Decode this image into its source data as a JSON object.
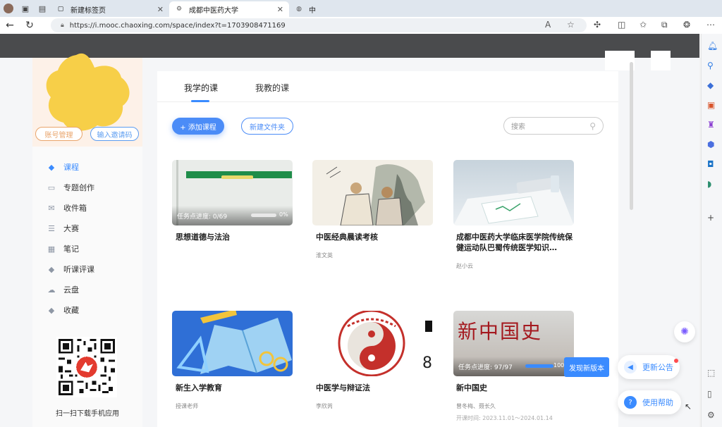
{
  "browser": {
    "tabs": [
      {
        "title": "新建标签页",
        "active": false
      },
      {
        "title": "成都中医药大学",
        "active": true
      },
      {
        "title": "中",
        "active": false
      }
    ],
    "url": "https://i.mooc.chaoxing.com/space/index?t=1703908471169",
    "url_host": "i.mooc.chaoxing.com"
  },
  "profile": {
    "account_btn": "账号管理",
    "invite_btn": "输入邀请码"
  },
  "sidebar": {
    "items": [
      {
        "label": "课程",
        "icon": "graduation-cap-icon",
        "active": true
      },
      {
        "label": "专题创作",
        "icon": "topic-icon",
        "active": false
      },
      {
        "label": "收件箱",
        "icon": "inbox-icon",
        "active": false
      },
      {
        "label": "大赛",
        "icon": "list-icon",
        "active": false
      },
      {
        "label": "笔记",
        "icon": "note-icon",
        "active": false
      },
      {
        "label": "听课评课",
        "icon": "graduation-cap-icon",
        "active": false
      },
      {
        "label": "云盘",
        "icon": "cloud-icon",
        "active": false
      },
      {
        "label": "收藏",
        "icon": "graduation-cap-icon",
        "active": false
      }
    ],
    "qr_caption": "扫一扫下载手机应用"
  },
  "main": {
    "tabs": [
      {
        "label": "我学的课",
        "active": true
      },
      {
        "label": "我教的课",
        "active": false
      }
    ],
    "add_course": "+ 添加课程",
    "new_folder": "新建文件夹",
    "search_placeholder": "搜索",
    "courses": [
      {
        "title": "思想道德与法治",
        "teacher": "",
        "progress_label": "任务点进度: 0/69",
        "progress_pct": "0%",
        "progress": 0
      },
      {
        "title": "中医经典晨读考核",
        "teacher": "淮文英"
      },
      {
        "title": "成都中医药大学临床医学院传统保健运动队巴蜀传统医学知识…",
        "teacher": "赵小云"
      },
      {
        "title": "新生入学教育",
        "teacher": "授课老师"
      },
      {
        "title": "中医学与辩证法",
        "teacher": "李欣芮"
      },
      {
        "title": "新中国史",
        "teacher": "曾冬梅、聂长久",
        "date": "开课时间: 2023.11.01～2024.01.14",
        "progress_label": "任务点进度: 97/97",
        "progress_pct": "100%",
        "progress": 1.0
      }
    ],
    "card4_side_text": "8",
    "card3_overlay": "新中国史"
  },
  "floating": {
    "discover": "发现新版本",
    "announcement": "更新公告",
    "help": "使用帮助"
  },
  "colors": {
    "accent": "#3a8bff",
    "dark_band": "#4a4b4d"
  }
}
